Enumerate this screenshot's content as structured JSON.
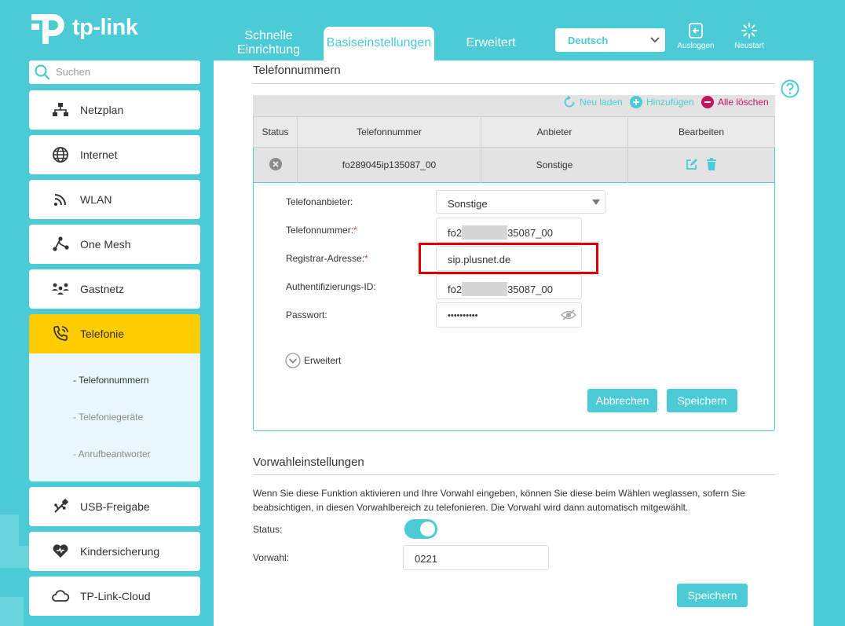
{
  "brand": {
    "name": "tp-link",
    "accent": "#4acbd6",
    "active_nav": "#ffcc00",
    "danger": "#c2185b"
  },
  "header": {
    "tabs": [
      {
        "line1": "Schnelle",
        "line2": "Einrichtung"
      },
      {
        "label": "Basiseinstellungen"
      },
      {
        "label": "Erweitert"
      }
    ],
    "language": "Deutsch",
    "logout_label": "Ausloggen",
    "restart_label": "Neustart"
  },
  "sidebar": {
    "search_placeholder": "Suchen",
    "items": [
      {
        "label": "Netzplan",
        "icon": "network-map-icon"
      },
      {
        "label": "Internet",
        "icon": "globe-icon"
      },
      {
        "label": "WLAN",
        "icon": "wifi-icon"
      },
      {
        "label": "One Mesh",
        "icon": "mesh-icon"
      },
      {
        "label": "Gastnetz",
        "icon": "guest-network-icon"
      },
      {
        "label": "Telefonie",
        "icon": "phone-icon"
      },
      {
        "label": "USB-Freigabe",
        "icon": "usb-icon"
      },
      {
        "label": "Kindersicherung",
        "icon": "heart-icon"
      },
      {
        "label": "TP-Link-Cloud",
        "icon": "cloud-icon"
      }
    ],
    "submenu": [
      "- Telefonnummern",
      "- Telefoniegeräte",
      "- Anrufbeantworter"
    ]
  },
  "phone_numbers": {
    "title": "Telefonnummern",
    "toolbar": {
      "reload": "Neu laden",
      "add": "Hinzufügen",
      "delete_all": "Alle löschen"
    },
    "columns": [
      "Status",
      "Telefonnummer",
      "Anbieter",
      "Bearbeiten"
    ],
    "rows": [
      {
        "status": "inactive",
        "number": "fo289045ip135087_00",
        "provider": "Sonstige"
      }
    ],
    "form": {
      "provider_label": "Telefonanbieter:",
      "provider_value": "Sonstige",
      "number_label": "Telefonnummer:",
      "number_prefix": "fo2",
      "number_suffix": "35087_00",
      "registrar_label": "Registrar-Adresse:",
      "registrar_value": "sip.plusnet.de",
      "auth_label": "Authentifizierungs-ID:",
      "auth_prefix": "fo2",
      "auth_suffix": "35087_00",
      "password_label": "Passwort:",
      "password_value": "••••••••••",
      "required_mark": "*",
      "advanced": "Erweitert",
      "cancel": "Abbrechen",
      "save": "Speichern"
    }
  },
  "area_code": {
    "title": "Vorwahleinstellungen",
    "description": "Wenn Sie diese Funktion aktivieren und Ihre Vorwahl eingeben, können Sie diese beim Wählen weglassen, sofern Sie beabsichtigen, in diesen Vorwahlbereich zu telefonieren. Die Vorwahl wird dann automatisch mitgewählt.",
    "status_label": "Status:",
    "status_on": true,
    "code_label": "Vorwahl:",
    "code_value": "0221",
    "save": "Speichern"
  }
}
